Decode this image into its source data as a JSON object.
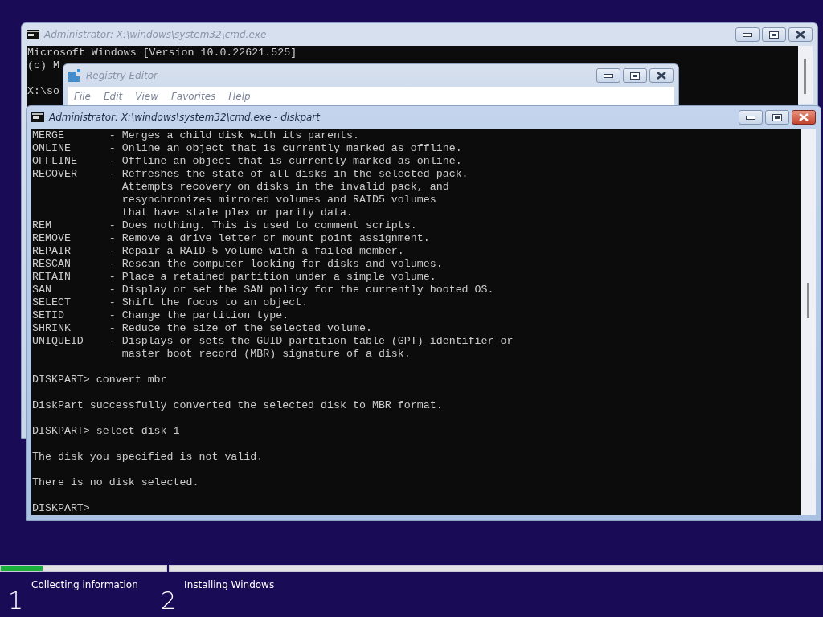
{
  "windows": [
    {
      "kind": "console",
      "title": "Administrator: X:\\windows\\system32\\cmd.exe",
      "active": false,
      "paragraphs": [
        [
          "Microsoft Windows [Version 10.0.22621.525]",
          "(c) M"
        ],
        [
          "X:\\so"
        ]
      ]
    },
    {
      "kind": "registry",
      "title": "Registry Editor",
      "active": false,
      "menu": [
        "File",
        "Edit",
        "View",
        "Favorites",
        "Help"
      ]
    },
    {
      "kind": "console",
      "title": "Administrator: X:\\windows\\system32\\cmd.exe - diskpart",
      "active": true,
      "paragraphs": [
        [
          "MERGE       - Merges a child disk with its parents.",
          "ONLINE      - Online an object that is currently marked as offline.",
          "OFFLINE     - Offline an object that is currently marked as online.",
          "RECOVER     - Refreshes the state of all disks in the selected pack.",
          "              Attempts recovery on disks in the invalid pack, and",
          "              resynchronizes mirrored volumes and RAID5 volumes",
          "              that have stale plex or parity data.",
          "REM         - Does nothing. This is used to comment scripts.",
          "REMOVE      - Remove a drive letter or mount point assignment.",
          "REPAIR      - Repair a RAID-5 volume with a failed member.",
          "RESCAN      - Rescan the computer looking for disks and volumes.",
          "RETAIN      - Place a retained partition under a simple volume.",
          "SAN         - Display or set the SAN policy for the currently booted OS.",
          "SELECT      - Shift the focus to an object.",
          "SETID       - Change the partition type.",
          "SHRINK      - Reduce the size of the selected volume.",
          "UNIQUEID    - Displays or sets the GUID partition table (GPT) identifier or",
          "              master boot record (MBR) signature of a disk."
        ],
        [
          "DISKPART> convert mbr"
        ],
        [
          "DiskPart successfully converted the selected disk to MBR format."
        ],
        [
          "DISKPART> select disk 1"
        ],
        [
          "The disk you specified is not valid."
        ],
        [
          "There is no disk selected."
        ],
        [
          "DISKPART>"
        ]
      ]
    }
  ],
  "setup_steps": [
    {
      "number": "1",
      "label": "Collecting information",
      "level": 0.25
    },
    {
      "number": "2",
      "label": "Installing Windows"
    }
  ]
}
